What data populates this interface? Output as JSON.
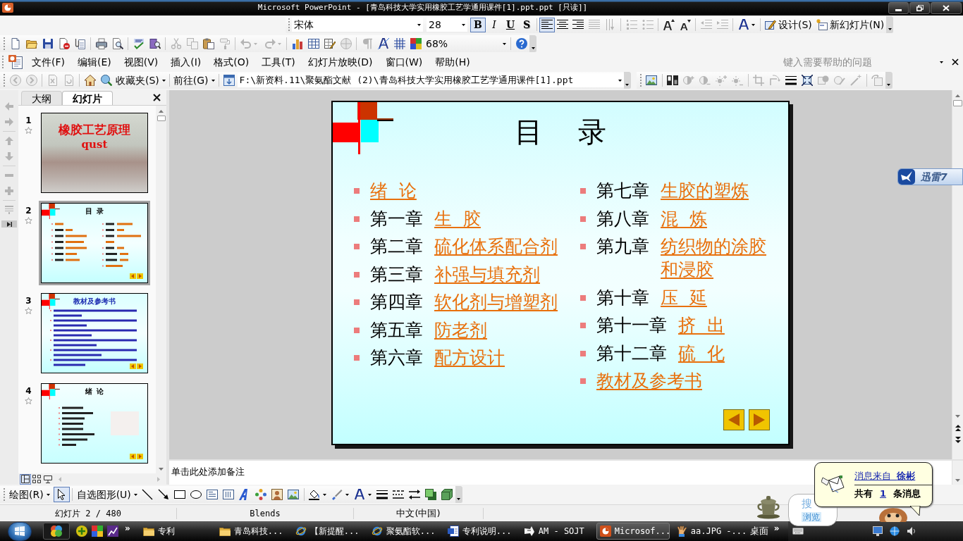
{
  "window": {
    "title": "Microsoft PowerPoint - [青岛科技大学实用橡胶工艺学通用课件[1].ppt.ppt [只读]]"
  },
  "formatting_toolbar": {
    "font": "宋体",
    "font_size": "28",
    "style_buttons": [
      {
        "kind": "bold",
        "label": "B",
        "selected": true
      },
      {
        "kind": "italic",
        "label": "I",
        "selected": false
      },
      {
        "kind": "underline",
        "label": "U",
        "selected": false
      },
      {
        "kind": "shadow",
        "label": "S",
        "selected": false
      }
    ],
    "align_buttons": [
      {
        "kind": "left",
        "selected": true
      },
      {
        "kind": "center",
        "selected": false
      },
      {
        "kind": "right",
        "selected": false
      }
    ],
    "design_button": "设计(S)",
    "new_slide_button": "新幻灯片(N)"
  },
  "standard_toolbar": {
    "zoom": "68%"
  },
  "menu_bar": {
    "items": [
      "文件(F)",
      "编辑(E)",
      "视图(V)",
      "插入(I)",
      "格式(O)",
      "工具(T)",
      "幻灯片放映(D)",
      "窗口(W)",
      "帮助(H)"
    ],
    "help_search": {
      "placeholder": "键入需要帮助的问题"
    }
  },
  "web_toolbar": {
    "favorites": "收藏夹(S)",
    "go": "前往(G)",
    "address": "F:\\新资料.11\\聚氨酯文献 (2)\\青岛科技大学实用橡胶工艺学通用课件[1].ppt"
  },
  "side_panel": {
    "tabs": [
      {
        "label": "大纲",
        "selected": false
      },
      {
        "label": "幻灯片",
        "selected": true
      }
    ],
    "slides": [
      {
        "number": "1",
        "kind": "photo_title",
        "title": "橡胶工艺原理",
        "subtitle": "qust",
        "selected": false
      },
      {
        "number": "2",
        "kind": "contents",
        "title": "目  录",
        "selected": true
      },
      {
        "number": "3",
        "kind": "references",
        "title": "教材及参考书",
        "selected": false
      },
      {
        "number": "4",
        "kind": "outline",
        "title": "绪  论",
        "selected": false
      }
    ],
    "view_buttons": [
      {
        "kind": "normal",
        "selected": true
      },
      {
        "kind": "sorter",
        "selected": false
      },
      {
        "kind": "show",
        "selected": false
      }
    ]
  },
  "slide": {
    "title": "目    录",
    "columns": [
      [
        {
          "link": "绪  论"
        },
        {
          "chapter": "第一章",
          "link": "生  胶"
        },
        {
          "chapter": "第二章",
          "link": "硫化体系配合剂"
        },
        {
          "chapter": "第三章",
          "link": "补强与填充剂"
        },
        {
          "chapter": "第四章",
          "link": "软化剂与增塑剂"
        },
        {
          "chapter": "第五章",
          "link": "防老剂"
        },
        {
          "chapter": "第六章",
          "link": "配方设计"
        }
      ],
      [
        {
          "chapter": "第七章",
          "link": "生胶的塑炼"
        },
        {
          "chapter": "第八章",
          "link": "混  炼"
        },
        {
          "chapter": "第九章",
          "link": "纺织物的涂胶和浸胶"
        },
        {
          "chapter": "第十章",
          "link": "压  延"
        },
        {
          "chapter": "第十一章",
          "link": "挤  出"
        },
        {
          "chapter": "第十二章",
          "link": "硫  化"
        },
        {
          "link": "教材及参考书"
        }
      ]
    ]
  },
  "notes": {
    "placeholder": "单击此处添加备注"
  },
  "drawing_toolbar": {
    "draw_menu": "绘图(R)",
    "autoshapes": "自选图形(U)",
    "select_tool": {
      "selected": true
    }
  },
  "status_bar": {
    "slide_position": "幻灯片 2 / 480",
    "design": "Blends",
    "language": "中文(中国)"
  },
  "taskbar": {
    "quick_launch_more": "»",
    "tasks": [
      {
        "label": "专利",
        "kind": "folder",
        "selected": false
      },
      {
        "label": "青岛科技...",
        "kind": "folder",
        "selected": false
      },
      {
        "label": "【新提醒...",
        "kind": "browser",
        "selected": false
      },
      {
        "label": "聚氨酯软...",
        "kind": "browser",
        "selected": false
      },
      {
        "label": "专利说明...",
        "kind": "word",
        "selected": false
      },
      {
        "label": "AM - SOJT",
        "kind": "app",
        "selected": false
      },
      {
        "label": "Microsof...",
        "kind": "powerpoint",
        "selected": true
      },
      {
        "label": "aa.JPG -...",
        "kind": "image",
        "selected": false
      }
    ],
    "desktop": "桌面",
    "desktop_more": "»"
  },
  "xunlei": {
    "label": "迅雷7"
  },
  "sogou": {
    "search": "搜",
    "browse": "浏览"
  },
  "notification": {
    "link": "消息来自  **徐彬**",
    "count_prefix": "共有",
    "count": "1",
    "count_suffix": "条消息"
  }
}
